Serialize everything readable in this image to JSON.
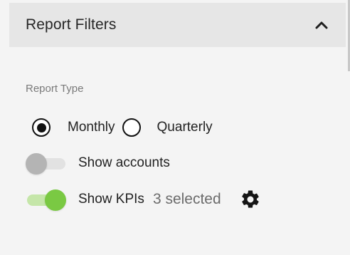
{
  "panel": {
    "title": "Report Filters",
    "collapse_icon": "chevron-up-icon"
  },
  "report_type": {
    "label": "Report Type",
    "options": [
      {
        "label": "Monthly",
        "selected": true
      },
      {
        "label": "Quarterly",
        "selected": false
      }
    ]
  },
  "toggles": {
    "show_accounts": {
      "label": "Show accounts",
      "on": false
    },
    "show_kpis": {
      "label": "Show KPIs",
      "on": true,
      "selected_text": "3 selected",
      "settings_icon": "gear-icon"
    }
  },
  "colors": {
    "toggle_on": "#7ac943",
    "toggle_on_track": "#c5e6a9",
    "toggle_off": "#b4b4b4",
    "header_bg": "#e6e6e6"
  }
}
